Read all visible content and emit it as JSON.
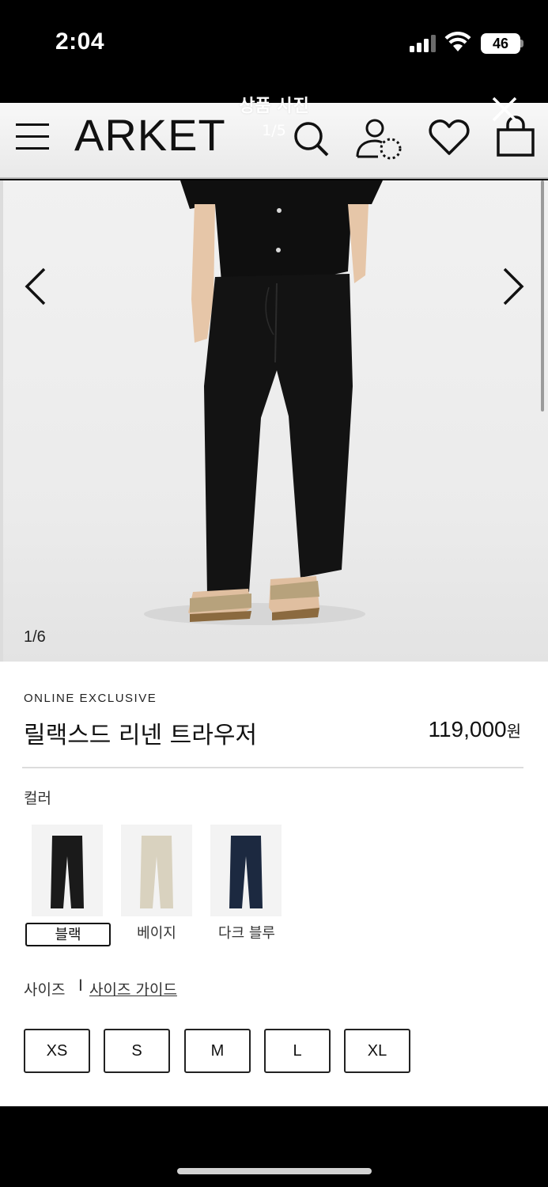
{
  "status_bar": {
    "time": "2:04",
    "battery": "46"
  },
  "viewer": {
    "title": "상품 사진",
    "counter": "1/5"
  },
  "header": {
    "logo": "ARKET"
  },
  "gallery": {
    "counter": "1/6"
  },
  "product": {
    "tag": "ONLINE EXCLUSIVE",
    "name": "릴랙스드 리넨 트라우저",
    "price": "119,000",
    "currency": "원"
  },
  "colors": {
    "label": "컬러",
    "options": [
      {
        "label": "블랙",
        "hex": "#1a1a1a",
        "selected": true
      },
      {
        "label": "베이지",
        "hex": "#d9d2bf",
        "selected": false
      },
      {
        "label": "다크 블루",
        "hex": "#1c2940",
        "selected": false
      }
    ]
  },
  "sizes": {
    "label": "사이즈",
    "separator": "I",
    "guide": "사이즈 가이드",
    "options": [
      "XS",
      "S",
      "M",
      "L",
      "XL"
    ]
  },
  "icons": [
    "menu-icon",
    "search-icon",
    "account-icon",
    "heart-icon",
    "bag-icon",
    "close-icon",
    "chevron-left-icon",
    "chevron-right-icon"
  ]
}
